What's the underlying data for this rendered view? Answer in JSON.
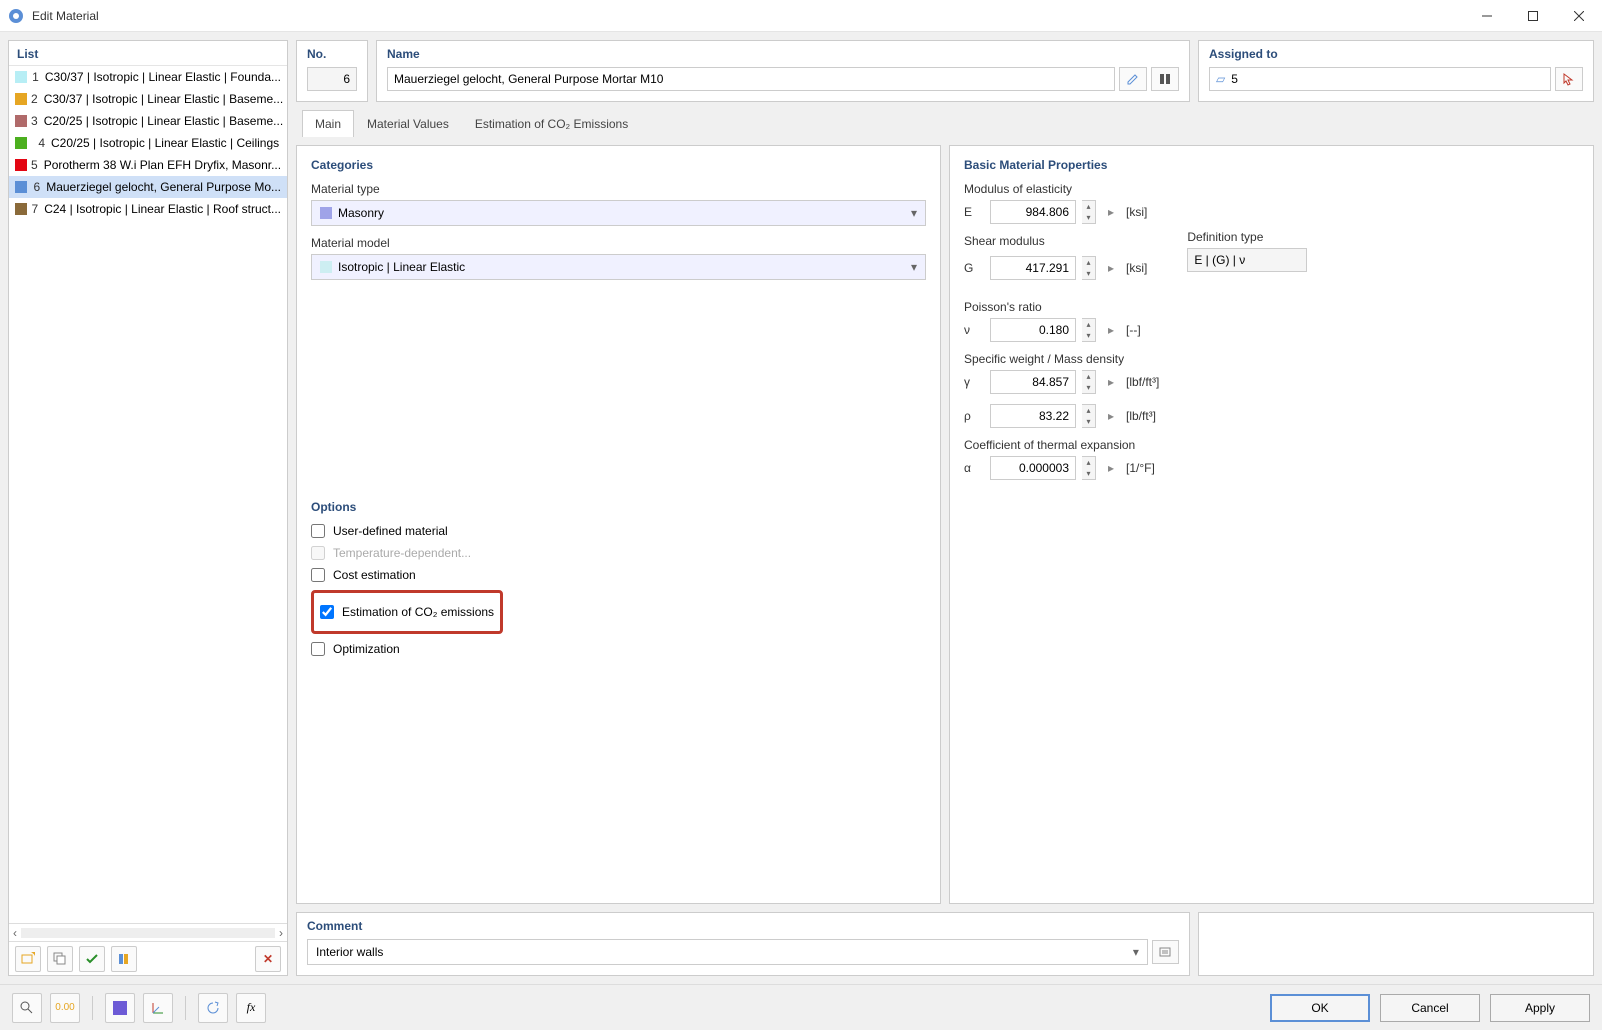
{
  "window": {
    "title": "Edit Material"
  },
  "sidebar": {
    "header": "List",
    "items": [
      {
        "num": "1",
        "color": "#b7eef5",
        "label": "C30/37 | Isotropic | Linear Elastic | Founda..."
      },
      {
        "num": "2",
        "color": "#e6a623",
        "label": "C30/37 | Isotropic | Linear Elastic | Baseme..."
      },
      {
        "num": "3",
        "color": "#b06a6a",
        "label": "C20/25 | Isotropic | Linear Elastic | Baseme..."
      },
      {
        "num": "4",
        "color": "#4caf1f",
        "label": "C20/25 | Isotropic | Linear Elastic | Ceilings"
      },
      {
        "num": "5",
        "color": "#e30613",
        "label": "Porotherm 38 W.i Plan EFH Dryfix, Masonr..."
      },
      {
        "num": "6",
        "color": "#5b8fd6",
        "label": "Mauerziegel gelocht, General Purpose Mo..."
      },
      {
        "num": "7",
        "color": "#8a6a3a",
        "label": "C24 | Isotropic | Linear Elastic | Roof struct..."
      }
    ],
    "selected_index": 5
  },
  "header": {
    "no_label": "No.",
    "no_value": "6",
    "name_label": "Name",
    "name_value": "Mauerziegel gelocht, General Purpose Mortar M10",
    "assigned_label": "Assigned to",
    "assigned_value": "5"
  },
  "tabs": {
    "items": [
      "Main",
      "Material Values",
      "Estimation of CO₂ Emissions"
    ],
    "active": 0
  },
  "categories": {
    "header": "Categories",
    "type_label": "Material type",
    "type_value": "Masonry",
    "type_swatch": "#9fa3e8",
    "model_label": "Material model",
    "model_value": "Isotropic | Linear Elastic",
    "model_swatch": "#cdeef2"
  },
  "options": {
    "header": "Options",
    "items": [
      {
        "label": "User-defined material",
        "checked": false,
        "disabled": false
      },
      {
        "label": "Temperature-dependent...",
        "checked": false,
        "disabled": true
      },
      {
        "label": "Cost estimation",
        "checked": false,
        "disabled": false
      },
      {
        "label": "Estimation of CO₂ emissions",
        "checked": true,
        "disabled": false,
        "highlight": true
      },
      {
        "label": "Optimization",
        "checked": false,
        "disabled": false
      }
    ]
  },
  "props": {
    "header": "Basic Material Properties",
    "rows": [
      {
        "title": "Modulus of elasticity",
        "sym": "E",
        "val": "984.806",
        "unit": "[ksi]"
      },
      {
        "title": "Shear modulus",
        "sym": "G",
        "val": "417.291",
        "unit": "[ksi]",
        "deftype_label": "Definition type",
        "deftype_value": "E | (G) | ν"
      },
      {
        "title": "Poisson's ratio",
        "sym": "ν",
        "val": "0.180",
        "unit": "[--]"
      },
      {
        "title": "Specific weight / Mass density",
        "sym": "γ",
        "val": "84.857",
        "unit": "[lbf/ft³]",
        "extra_sym": "ρ",
        "extra_val": "83.22",
        "extra_unit": "[lb/ft³]"
      },
      {
        "title": "Coefficient of thermal expansion",
        "sym": "α",
        "val": "0.000003",
        "unit": "[1/°F]"
      }
    ]
  },
  "comment": {
    "header": "Comment",
    "value": "Interior walls"
  },
  "footer": {
    "ok": "OK",
    "cancel": "Cancel",
    "apply": "Apply"
  }
}
